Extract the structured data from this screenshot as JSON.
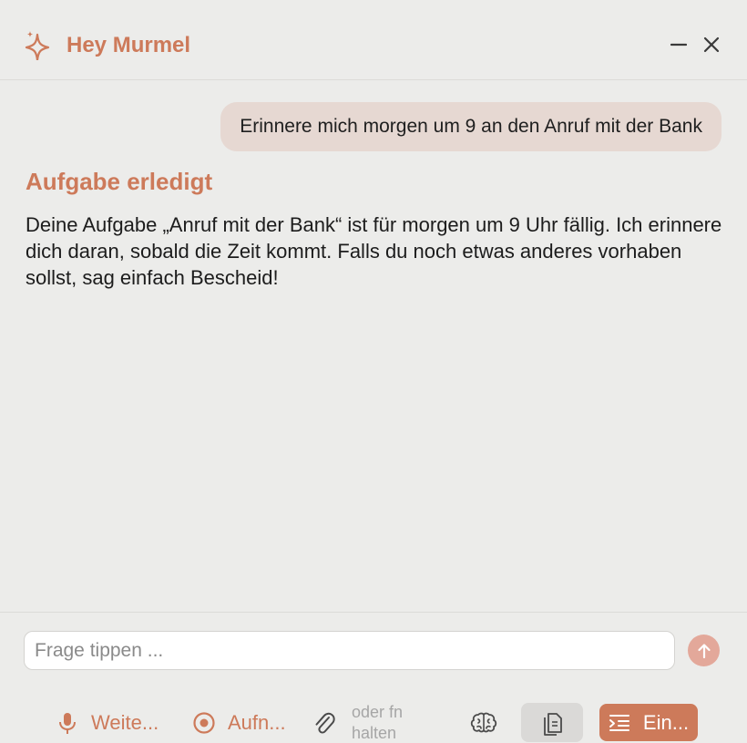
{
  "header": {
    "title": "Hey Murmel",
    "icon": "sparkle-icon",
    "accent_color": "#cd7a5a"
  },
  "conversation": {
    "user_message": "Erinnere mich morgen um 9 an den Anruf mit der Bank",
    "reply_title": "Aufgabe erledigt",
    "reply_body": "Deine Aufgabe „Anruf mit der Bank“ ist für morgen um 9 Uhr fällig. Ich erinnere dich daran, sobald die Zeit kommt. Falls du noch etwas anderes vorhaben sollst, sag einfach Bescheid!"
  },
  "composer": {
    "placeholder": "Frage tippen ...",
    "value": ""
  },
  "toolbar": {
    "mic_label": "Weite...",
    "record_label": "Aufn...",
    "hint": "oder fn halten",
    "settings_label": "Ein..."
  }
}
